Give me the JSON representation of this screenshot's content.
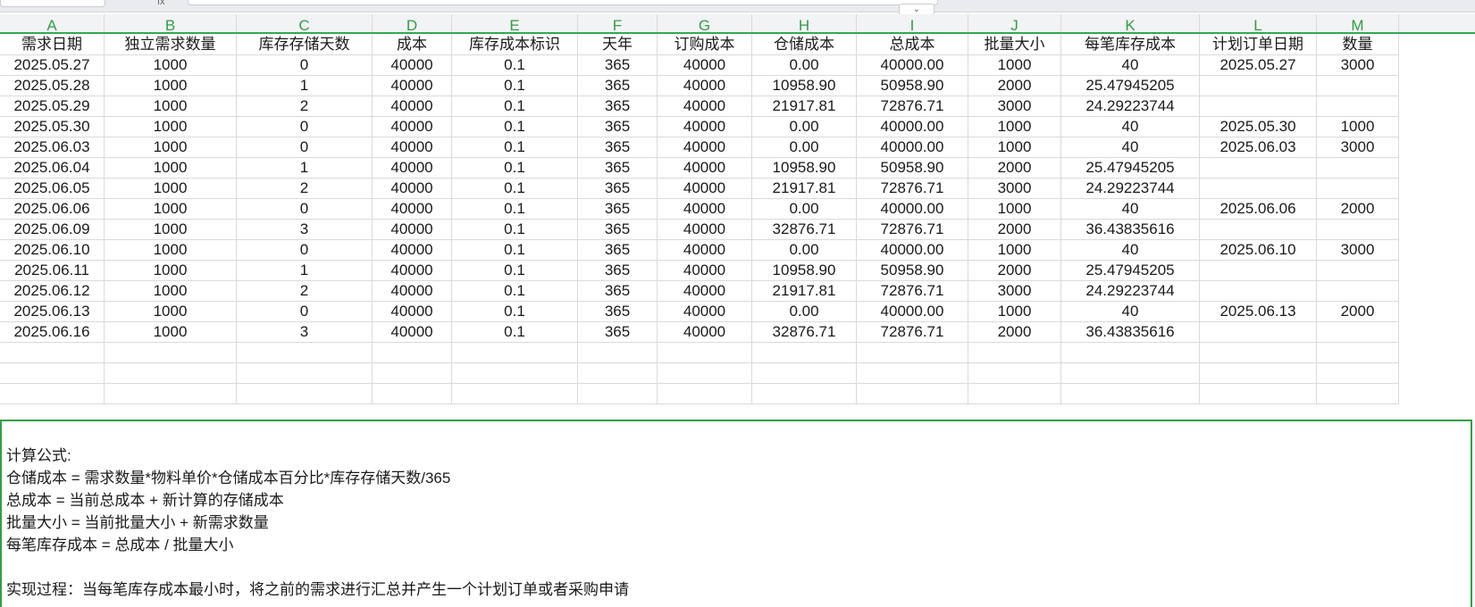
{
  "columns": [
    "A",
    "B",
    "C",
    "D",
    "E",
    "F",
    "G",
    "H",
    "I",
    "J",
    "K",
    "L",
    "M"
  ],
  "headers": [
    "需求日期",
    "独立需求数量",
    "库存存储天数",
    "成本",
    "库存成本标识",
    "天年",
    "订购成本",
    "仓储成本",
    "总成本",
    "批量大小",
    "每笔库存成本",
    "计划订单日期",
    "数量"
  ],
  "rows": [
    [
      "2025.05.27",
      "1000",
      "0",
      "40000",
      "0.1",
      "365",
      "40000",
      "0.00",
      "40000.00",
      "1000",
      "40",
      "2025.05.27",
      "3000"
    ],
    [
      "2025.05.28",
      "1000",
      "1",
      "40000",
      "0.1",
      "365",
      "40000",
      "10958.90",
      "50958.90",
      "2000",
      "25.47945205",
      "",
      ""
    ],
    [
      "2025.05.29",
      "1000",
      "2",
      "40000",
      "0.1",
      "365",
      "40000",
      "21917.81",
      "72876.71",
      "3000",
      "24.29223744",
      "",
      ""
    ],
    [
      "2025.05.30",
      "1000",
      "0",
      "40000",
      "0.1",
      "365",
      "40000",
      "0.00",
      "40000.00",
      "1000",
      "40",
      "2025.05.30",
      "1000"
    ],
    [
      "2025.06.03",
      "1000",
      "0",
      "40000",
      "0.1",
      "365",
      "40000",
      "0.00",
      "40000.00",
      "1000",
      "40",
      "2025.06.03",
      "3000"
    ],
    [
      "2025.06.04",
      "1000",
      "1",
      "40000",
      "0.1",
      "365",
      "40000",
      "10958.90",
      "50958.90",
      "2000",
      "25.47945205",
      "",
      ""
    ],
    [
      "2025.06.05",
      "1000",
      "2",
      "40000",
      "0.1",
      "365",
      "40000",
      "21917.81",
      "72876.71",
      "3000",
      "24.29223744",
      "",
      ""
    ],
    [
      "2025.06.06",
      "1000",
      "0",
      "40000",
      "0.1",
      "365",
      "40000",
      "0.00",
      "40000.00",
      "1000",
      "40",
      "2025.06.06",
      "2000"
    ],
    [
      "2025.06.09",
      "1000",
      "3",
      "40000",
      "0.1",
      "365",
      "40000",
      "32876.71",
      "72876.71",
      "2000",
      "36.43835616",
      "",
      ""
    ],
    [
      "2025.06.10",
      "1000",
      "0",
      "40000",
      "0.1",
      "365",
      "40000",
      "0.00",
      "40000.00",
      "1000",
      "40",
      "2025.06.10",
      "3000"
    ],
    [
      "2025.06.11",
      "1000",
      "1",
      "40000",
      "0.1",
      "365",
      "40000",
      "10958.90",
      "50958.90",
      "2000",
      "25.47945205",
      "",
      ""
    ],
    [
      "2025.06.12",
      "1000",
      "2",
      "40000",
      "0.1",
      "365",
      "40000",
      "21917.81",
      "72876.71",
      "3000",
      "24.29223744",
      "",
      ""
    ],
    [
      "2025.06.13",
      "1000",
      "0",
      "40000",
      "0.1",
      "365",
      "40000",
      "0.00",
      "40000.00",
      "1000",
      "40",
      "2025.06.13",
      "2000"
    ],
    [
      "2025.06.16",
      "1000",
      "3",
      "40000",
      "0.1",
      "365",
      "40000",
      "32876.71",
      "72876.71",
      "2000",
      "36.43835616",
      "",
      ""
    ],
    [
      "",
      "",
      "",
      "",
      "",
      "",
      "",
      "",
      "",
      "",
      "",
      "",
      ""
    ],
    [
      "",
      "",
      "",
      "",
      "",
      "",
      "",
      "",
      "",
      "",
      "",
      "",
      ""
    ],
    [
      "",
      "",
      "",
      "",
      "",
      "",
      "",
      "",
      "",
      "",
      "",
      "",
      ""
    ]
  ],
  "note": {
    "title": "计算公式:",
    "line1": "仓储成本 = 需求数量*物料单价*仓储成本百分比*库存存储天数/365",
    "line2": "总成本 = 当前总成本 + 新计算的存储成本",
    "line3": "批量大小 = 当前批量大小 + 新需求数量",
    "line4": "每笔库存成本 = 总成本 / 批量大小",
    "line5": "实现过程：当每笔库存成本最小时，将之前的需求进行汇总并产生一个计划订单或者采购申请"
  },
  "toolbar": {
    "fx": "fx",
    "expand": "⌄"
  },
  "colors": {
    "accent": "#34a853",
    "header_text": "#2f9e44",
    "grid": "#dadada"
  }
}
